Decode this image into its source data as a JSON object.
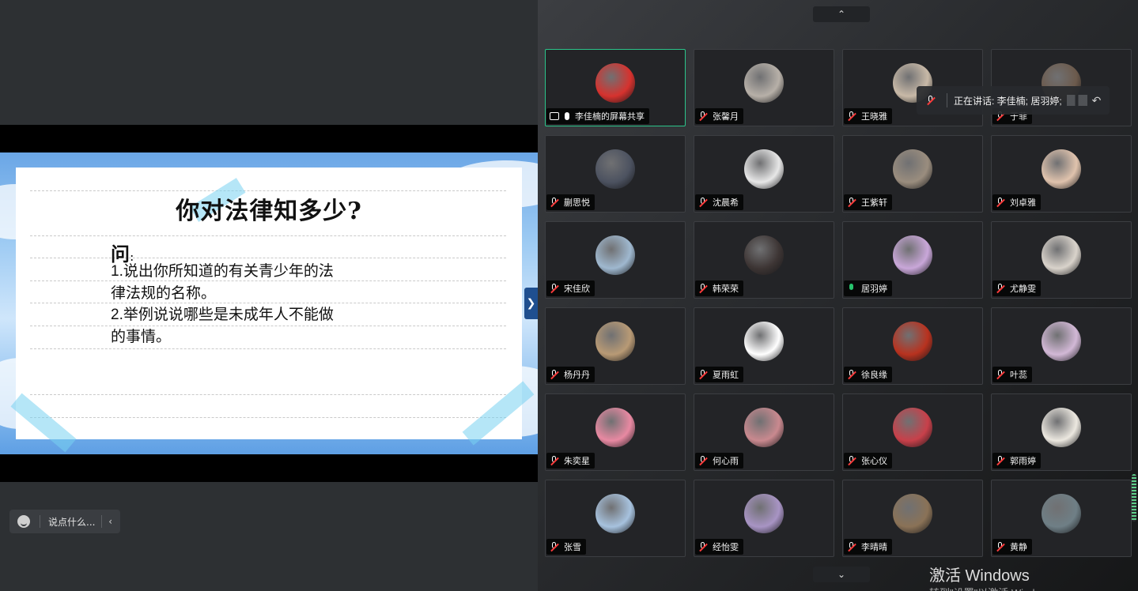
{
  "slide": {
    "title": "你对法律知多少?",
    "question_label": "问",
    "question_colon": ":",
    "lines": [
      "1.说出你所知道的有关青少年的法",
      "律法规的名称。",
      "2.举例说说哪些是未成年人不能做",
      "的事情。"
    ]
  },
  "chat": {
    "placeholder": "说点什么..."
  },
  "speaking_banner": {
    "text": "正在讲话: 李佳楠; 居羽婷;"
  },
  "participants": [
    {
      "name": "李佳楠的屏幕共享",
      "mic": "on",
      "sharing": true,
      "avatar_color": "#d6322e"
    },
    {
      "name": "张馨月",
      "mic": "muted",
      "avatar_color": "#b7b0a8"
    },
    {
      "name": "王晓雅",
      "mic": "muted",
      "avatar_color": "#c8b9a7"
    },
    {
      "name": "于菲",
      "mic": "muted",
      "avatar_color": "#6c5a4c"
    },
    {
      "name": "蒯思悦",
      "mic": "muted",
      "avatar_color": "#4c5260"
    },
    {
      "name": "沈晨希",
      "mic": "muted",
      "avatar_color": "#e7e7e7"
    },
    {
      "name": "王紫轩",
      "mic": "muted",
      "avatar_color": "#9a8d7e"
    },
    {
      "name": "刘卓雅",
      "mic": "muted",
      "avatar_color": "#e0c3ad"
    },
    {
      "name": "宋佳欣",
      "mic": "muted",
      "avatar_color": "#9fb8cf"
    },
    {
      "name": "韩荣荣",
      "mic": "muted",
      "avatar_color": "#3d3534"
    },
    {
      "name": "居羽婷",
      "mic": "on",
      "avatar_color": "#c9a7d9"
    },
    {
      "name": "尤静雯",
      "mic": "muted",
      "avatar_color": "#d9d3cb"
    },
    {
      "name": "杨丹丹",
      "mic": "muted",
      "avatar_color": "#b89a75"
    },
    {
      "name": "夏雨虹",
      "mic": "muted",
      "avatar_color": "#ffffff"
    },
    {
      "name": "徐良缘",
      "mic": "muted",
      "avatar_color": "#b8321f"
    },
    {
      "name": "叶蕊",
      "mic": "muted",
      "avatar_color": "#d2b8d6"
    },
    {
      "name": "朱奕星",
      "mic": "muted",
      "avatar_color": "#e889a2"
    },
    {
      "name": "何心雨",
      "mic": "muted",
      "avatar_color": "#c9898f"
    },
    {
      "name": "张心仪",
      "mic": "muted",
      "avatar_color": "#c8404a"
    },
    {
      "name": "郭雨婷",
      "mic": "muted",
      "avatar_color": "#ece8e0"
    },
    {
      "name": "张雪",
      "mic": "muted",
      "avatar_color": "#a7c2de"
    },
    {
      "name": "经怡雯",
      "mic": "muted",
      "avatar_color": "#a894c4"
    },
    {
      "name": "李晴晴",
      "mic": "muted",
      "avatar_color": "#8a7257"
    },
    {
      "name": "黄静",
      "mic": "muted",
      "avatar_color": "#6f7f86"
    }
  ],
  "watermark": {
    "title": "激活 Windows",
    "subtitle": "转到\"设置\"以激活 Windows。"
  },
  "colors": {
    "active_border": "#2bc48a",
    "muted_slash": "#ff3b3b",
    "mic_on": "#27c46d"
  }
}
